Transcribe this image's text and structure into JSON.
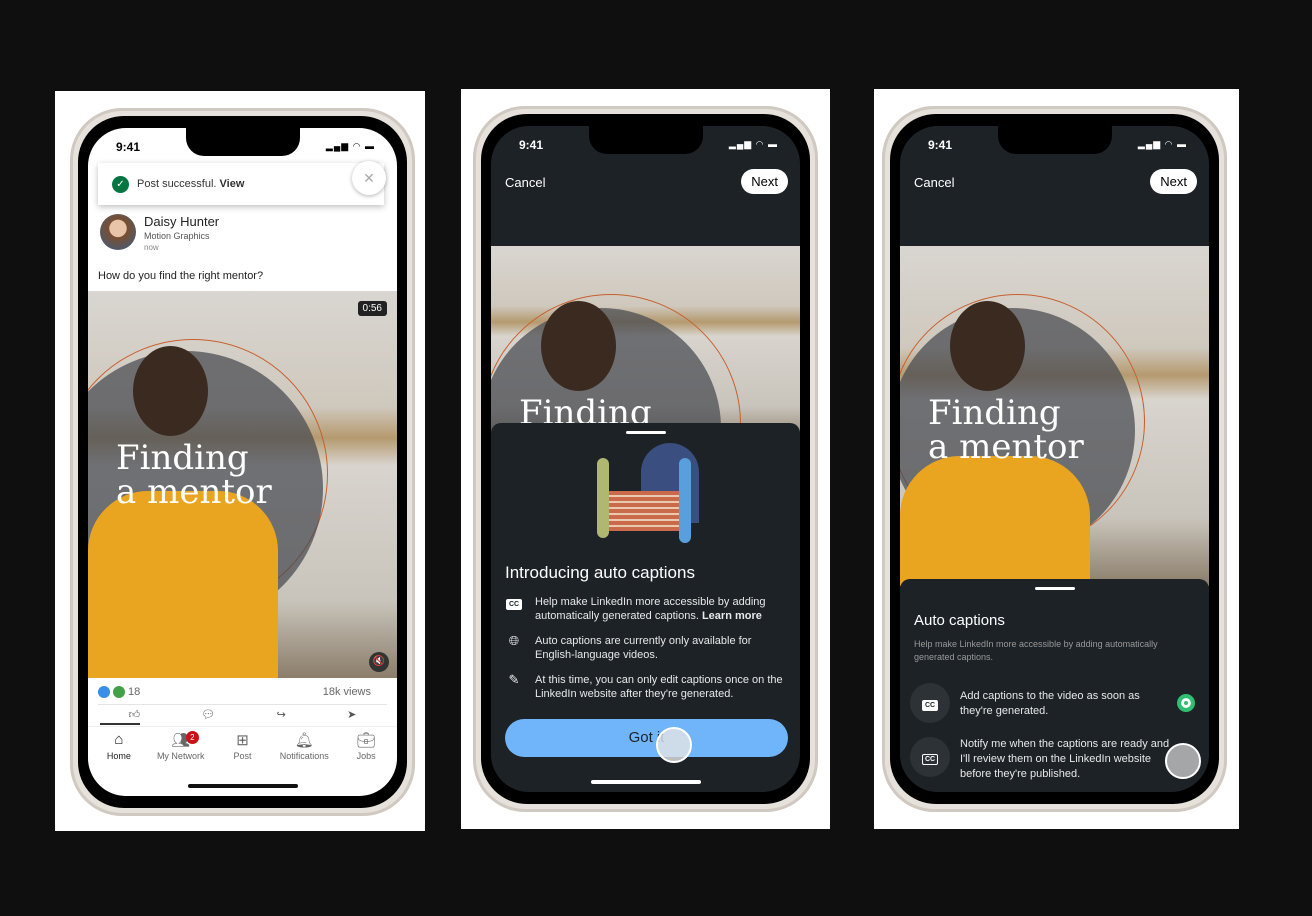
{
  "status_time": "9:41",
  "phone1": {
    "toast": {
      "text": "Post successful.",
      "link": "View"
    },
    "author": {
      "name": "Daisy Hunter",
      "headline": "Motion Graphics",
      "time": "now"
    },
    "post_text": "How do you find the right mentor?",
    "video": {
      "duration": "0:56",
      "title_line1": "Finding",
      "title_line2": "a mentor"
    },
    "reactions_count": "18",
    "views": "18k views",
    "nav": [
      {
        "label": "Home",
        "icon": "home-icon"
      },
      {
        "label": "My Network",
        "icon": "network-icon",
        "badge": "2"
      },
      {
        "label": "Post",
        "icon": "plus-square-icon"
      },
      {
        "label": "Notifications",
        "icon": "bell-icon"
      },
      {
        "label": "Jobs",
        "icon": "briefcase-icon"
      }
    ]
  },
  "phone2": {
    "cancel": "Cancel",
    "next": "Next",
    "video_title": "Finding",
    "title": "Introducing auto captions",
    "items": [
      {
        "icon": "cc-icon",
        "text": "Help make LinkedIn more accessible by adding automatically generated captions.",
        "link": "Learn more"
      },
      {
        "icon": "globe-icon",
        "text": "Auto captions are currently only available for English-language videos."
      },
      {
        "icon": "pencil-icon",
        "text": "At this time, you can only edit captions once on the LinkedIn website after they're generated."
      }
    ],
    "button": "Got it"
  },
  "phone3": {
    "cancel": "Cancel",
    "next": "Next",
    "video": {
      "title_line1": "Finding",
      "title_line2": "a mentor"
    },
    "title": "Auto captions",
    "subtitle": "Help make LinkedIn more accessible by adding automatically generated captions.",
    "options": [
      {
        "text": "Add captions to the video as soon as they're generated.",
        "selected": true
      },
      {
        "text": "Notify me when the captions are ready and I'll review them on the LinkedIn website before they're published.",
        "selected": false
      }
    ]
  },
  "colors": {
    "accent_blue": "#70b5f9",
    "success_green": "#057642",
    "radio_green": "#2fbf71",
    "badge_red": "#cc1016",
    "sheet_bg": "#1d2226"
  }
}
